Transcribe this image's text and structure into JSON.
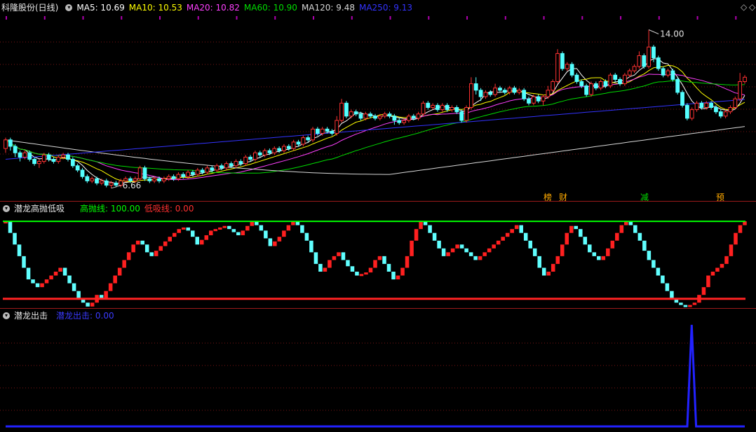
{
  "main_panel": {
    "title": "科隆股份(日线)",
    "ma_legend": [
      {
        "label": "MA5: 10.69",
        "color": "#ffffff"
      },
      {
        "label": "MA10: 10.53",
        "color": "#ffff00"
      },
      {
        "label": "MA20: 10.82",
        "color": "#ff40ff"
      },
      {
        "label": "MA60: 10.90",
        "color": "#00dd00"
      },
      {
        "label": "MA120: 9.48",
        "color": "#d8d8d8"
      },
      {
        "label": "MA250: 9.13",
        "color": "#3333ff"
      }
    ],
    "high_label": "14.00",
    "low_label": "6.66",
    "badges": [
      {
        "text": "榜",
        "color": "#ffaa00"
      },
      {
        "text": "财",
        "color": "#ffaa00"
      },
      {
        "text": "减",
        "color": "#00dd00"
      },
      {
        "text": "预",
        "color": "#ffaa00"
      }
    ]
  },
  "osc_panel": {
    "title": "潜龙高抛低吸",
    "high_label": "高抛线: 100.00",
    "low_label": "低吸线: 0.00",
    "high_color": "#00ff00",
    "low_color": "#ff2222"
  },
  "signal_panel": {
    "title": "潜龙出击",
    "label": "潜龙出击: 0.00",
    "color": "#2222ff"
  },
  "icons": {
    "collapse": "collapse-icon",
    "diamond": "diamond-icon",
    "corner": "corner-icon"
  },
  "chart_data": [
    {
      "type": "candlestick",
      "title": "科隆股份(日线)",
      "ylim": [
        6.2,
        14.6
      ],
      "annotations": [
        {
          "text": "14.00",
          "value": 14.0
        },
        {
          "text": "6.66",
          "value": 6.66
        }
      ],
      "candles": [
        [
          8.5,
          8.9,
          9.0,
          8.3
        ],
        [
          8.9,
          8.6,
          9.0,
          8.4
        ],
        [
          8.6,
          8.3,
          8.7,
          8.1
        ],
        [
          8.3,
          8.1,
          8.4,
          7.9
        ],
        [
          8.1,
          8.3,
          8.4,
          8.0
        ],
        [
          8.3,
          8.0,
          8.4,
          7.9
        ],
        [
          8.0,
          7.8,
          8.1,
          7.7
        ],
        [
          7.8,
          7.9,
          8.0,
          7.6
        ],
        [
          7.9,
          8.2,
          8.3,
          7.8
        ],
        [
          8.2,
          8.0,
          8.3,
          7.9
        ],
        [
          8.0,
          7.9,
          8.1,
          7.8
        ],
        [
          7.9,
          8.1,
          8.2,
          7.8
        ],
        [
          8.1,
          8.2,
          8.3,
          8.0
        ],
        [
          8.2,
          8.0,
          8.3,
          7.9
        ],
        [
          8.0,
          7.7,
          8.1,
          7.6
        ],
        [
          7.7,
          7.5,
          7.8,
          7.4
        ],
        [
          7.5,
          7.2,
          7.6,
          7.1
        ],
        [
          7.2,
          7.0,
          7.3,
          6.9
        ],
        [
          7.0,
          7.1,
          7.2,
          6.9
        ],
        [
          7.1,
          6.9,
          7.2,
          6.8
        ],
        [
          6.9,
          7.0,
          7.1,
          6.8
        ],
        [
          7.0,
          6.8,
          7.1,
          6.7
        ],
        [
          6.8,
          6.9,
          7.0,
          6.66
        ],
        [
          6.9,
          6.8,
          7.0,
          6.7
        ],
        [
          6.8,
          7.0,
          7.1,
          6.7
        ],
        [
          7.0,
          7.1,
          7.2,
          6.9
        ],
        [
          7.1,
          7.0,
          7.2,
          6.9
        ],
        [
          7.0,
          7.1,
          7.2,
          6.9
        ],
        [
          7.1,
          7.6,
          7.7,
          7.0
        ],
        [
          7.6,
          7.1,
          7.7,
          7.0
        ],
        [
          7.1,
          7.0,
          7.2,
          6.9
        ],
        [
          7.0,
          7.1,
          7.2,
          6.9
        ],
        [
          7.1,
          7.0,
          7.2,
          6.9
        ],
        [
          7.0,
          7.1,
          7.2,
          6.9
        ],
        [
          7.1,
          7.2,
          7.3,
          7.0
        ],
        [
          7.2,
          7.1,
          7.3,
          7.0
        ],
        [
          7.1,
          7.3,
          7.4,
          7.0
        ],
        [
          7.3,
          7.2,
          7.4,
          7.1
        ],
        [
          7.2,
          7.4,
          7.5,
          7.1
        ],
        [
          7.4,
          7.3,
          7.5,
          7.2
        ],
        [
          7.3,
          7.5,
          7.6,
          7.2
        ],
        [
          7.5,
          7.4,
          7.6,
          7.3
        ],
        [
          7.4,
          7.6,
          7.7,
          7.3
        ],
        [
          7.6,
          7.5,
          7.7,
          7.4
        ],
        [
          7.5,
          7.7,
          7.8,
          7.4
        ],
        [
          7.7,
          7.6,
          7.8,
          7.5
        ],
        [
          7.6,
          7.8,
          7.9,
          7.5
        ],
        [
          7.8,
          7.7,
          7.9,
          7.6
        ],
        [
          7.7,
          7.9,
          8.0,
          7.6
        ],
        [
          7.9,
          7.8,
          8.0,
          7.7
        ],
        [
          7.8,
          8.1,
          8.2,
          7.7
        ],
        [
          8.1,
          8.0,
          8.2,
          7.9
        ],
        [
          8.0,
          8.3,
          8.4,
          7.9
        ],
        [
          8.3,
          8.2,
          8.4,
          8.1
        ],
        [
          8.2,
          8.4,
          8.5,
          8.1
        ],
        [
          8.4,
          8.3,
          8.5,
          8.2
        ],
        [
          8.3,
          8.5,
          8.6,
          8.2
        ],
        [
          8.5,
          8.4,
          8.6,
          8.3
        ],
        [
          8.4,
          8.6,
          8.7,
          8.3
        ],
        [
          8.6,
          8.5,
          8.7,
          8.4
        ],
        [
          8.5,
          8.8,
          8.9,
          8.4
        ],
        [
          8.8,
          8.7,
          8.9,
          8.6
        ],
        [
          8.7,
          9.0,
          9.1,
          8.6
        ],
        [
          9.0,
          8.9,
          9.1,
          8.8
        ],
        [
          8.9,
          9.4,
          9.5,
          8.8
        ],
        [
          9.4,
          9.2,
          9.5,
          9.1
        ],
        [
          9.2,
          9.4,
          9.5,
          9.1
        ],
        [
          9.4,
          9.3,
          9.5,
          9.2
        ],
        [
          9.3,
          9.2,
          9.4,
          9.1
        ],
        [
          9.2,
          9.8,
          10.0,
          9.1
        ],
        [
          9.8,
          10.6,
          10.8,
          9.7
        ],
        [
          10.6,
          10.0,
          10.7,
          9.9
        ],
        [
          10.0,
          10.2,
          10.3,
          9.9
        ],
        [
          10.2,
          10.1,
          10.3,
          10.0
        ],
        [
          10.1,
          9.9,
          10.2,
          9.8
        ],
        [
          9.9,
          10.1,
          10.2,
          9.8
        ],
        [
          10.1,
          10.0,
          10.2,
          9.9
        ],
        [
          10.0,
          9.9,
          10.1,
          9.8
        ],
        [
          9.9,
          10.0,
          10.1,
          9.8
        ],
        [
          10.0,
          10.1,
          10.2,
          9.9
        ],
        [
          10.1,
          10.0,
          10.2,
          9.9
        ],
        [
          10.0,
          9.8,
          10.1,
          9.6
        ],
        [
          9.8,
          9.7,
          9.9,
          9.6
        ],
        [
          9.7,
          9.8,
          9.9,
          9.6
        ],
        [
          9.8,
          10.0,
          10.1,
          9.7
        ],
        [
          10.0,
          9.9,
          10.1,
          9.8
        ],
        [
          9.9,
          10.1,
          10.2,
          9.8
        ],
        [
          10.1,
          10.6,
          10.7,
          10.0
        ],
        [
          10.6,
          10.4,
          10.7,
          10.3
        ],
        [
          10.4,
          10.5,
          10.6,
          10.3
        ],
        [
          10.5,
          10.3,
          10.6,
          10.2
        ],
        [
          10.3,
          10.5,
          10.6,
          10.2
        ],
        [
          10.5,
          10.3,
          10.6,
          10.2
        ],
        [
          10.3,
          10.4,
          10.5,
          10.2
        ],
        [
          10.4,
          10.2,
          10.5,
          10.1
        ],
        [
          10.2,
          9.8,
          10.3,
          9.7
        ],
        [
          9.8,
          10.4,
          10.5,
          9.7
        ],
        [
          10.4,
          11.5,
          11.8,
          10.3
        ],
        [
          11.5,
          11.2,
          11.8,
          11.0
        ],
        [
          11.2,
          10.9,
          11.3,
          10.7
        ],
        [
          10.9,
          11.1,
          11.2,
          10.8
        ],
        [
          11.1,
          11.0,
          11.2,
          10.9
        ],
        [
          11.0,
          11.3,
          11.5,
          10.9
        ],
        [
          11.3,
          11.2,
          11.4,
          11.1
        ],
        [
          11.2,
          11.1,
          11.3,
          11.0
        ],
        [
          11.1,
          11.3,
          11.4,
          11.0
        ],
        [
          11.3,
          11.1,
          11.4,
          11.0
        ],
        [
          11.1,
          11.2,
          11.3,
          11.0
        ],
        [
          11.2,
          10.8,
          11.3,
          10.7
        ],
        [
          10.8,
          10.6,
          10.9,
          10.5
        ],
        [
          10.6,
          10.9,
          11.0,
          10.5
        ],
        [
          10.9,
          10.7,
          11.0,
          10.6
        ],
        [
          10.7,
          10.9,
          11.0,
          10.5
        ],
        [
          10.9,
          11.2,
          11.4,
          10.8
        ],
        [
          11.2,
          11.6,
          11.7,
          11.1
        ],
        [
          11.6,
          12.9,
          13.1,
          11.5
        ],
        [
          12.9,
          12.2,
          13.0,
          12.1
        ],
        [
          12.2,
          12.4,
          12.5,
          12.1
        ],
        [
          12.4,
          11.9,
          12.5,
          11.8
        ],
        [
          11.9,
          11.6,
          12.0,
          11.5
        ],
        [
          11.6,
          11.4,
          11.7,
          11.3
        ],
        [
          11.4,
          11.0,
          11.5,
          10.9
        ],
        [
          11.0,
          11.5,
          11.6,
          10.9
        ],
        [
          11.5,
          11.3,
          11.6,
          11.2
        ],
        [
          11.3,
          11.6,
          11.7,
          11.2
        ],
        [
          11.6,
          11.4,
          11.7,
          11.3
        ],
        [
          11.4,
          11.9,
          12.0,
          11.3
        ],
        [
          11.9,
          11.7,
          12.0,
          11.6
        ],
        [
          11.7,
          11.5,
          11.8,
          11.4
        ],
        [
          11.5,
          11.9,
          12.0,
          11.4
        ],
        [
          11.9,
          12.1,
          12.2,
          11.8
        ],
        [
          12.1,
          12.3,
          12.4,
          12.0
        ],
        [
          12.3,
          12.8,
          13.0,
          12.2
        ],
        [
          12.8,
          12.3,
          12.9,
          12.2
        ],
        [
          12.3,
          13.2,
          14.0,
          12.2
        ],
        [
          13.2,
          12.7,
          13.3,
          12.5
        ],
        [
          12.7,
          12.2,
          12.8,
          12.1
        ],
        [
          12.2,
          11.9,
          12.3,
          11.8
        ],
        [
          11.9,
          12.1,
          12.2,
          11.8
        ],
        [
          12.1,
          11.7,
          12.2,
          11.6
        ],
        [
          11.7,
          11.1,
          11.8,
          11.0
        ],
        [
          11.1,
          10.5,
          11.2,
          10.4
        ],
        [
          10.5,
          9.9,
          10.6,
          9.8
        ],
        [
          9.9,
          10.3,
          10.4,
          9.8
        ],
        [
          10.3,
          10.6,
          10.7,
          10.2
        ],
        [
          10.6,
          10.4,
          10.7,
          10.3
        ],
        [
          10.4,
          10.6,
          10.7,
          10.3
        ],
        [
          10.6,
          10.4,
          10.7,
          10.3
        ],
        [
          10.4,
          10.2,
          10.5,
          10.1
        ],
        [
          10.2,
          10.0,
          10.3,
          9.9
        ],
        [
          10.0,
          10.2,
          10.3,
          9.9
        ],
        [
          10.2,
          10.4,
          10.5,
          10.1
        ],
        [
          10.4,
          10.8,
          10.9,
          10.3
        ],
        [
          10.8,
          11.6,
          12.0,
          10.7
        ],
        [
          11.6,
          11.8,
          11.9,
          11.5
        ]
      ],
      "series": [
        {
          "name": "MA5",
          "color": "#ffffff"
        },
        {
          "name": "MA10",
          "color": "#ffff00"
        },
        {
          "name": "MA20",
          "color": "#ff40ff"
        },
        {
          "name": "MA60",
          "color": "#00dd00"
        },
        {
          "name": "MA120",
          "color": "#d8d8d8"
        },
        {
          "name": "MA250",
          "color": "#3333ff"
        }
      ]
    },
    {
      "type": "bar",
      "title": "潜龙高抛低吸",
      "ylim": [
        -12,
        110
      ],
      "reference_lines": [
        {
          "name": "高抛线",
          "value": 100
        },
        {
          "name": "低吸线",
          "value": 0
        }
      ],
      "values": [
        100,
        85,
        70,
        55,
        40,
        25,
        20,
        15,
        20,
        25,
        30,
        35,
        40,
        30,
        20,
        10,
        0,
        -5,
        -10,
        -5,
        5,
        0,
        10,
        20,
        30,
        40,
        50,
        60,
        70,
        75,
        70,
        60,
        55,
        62,
        68,
        74,
        80,
        85,
        90,
        92,
        88,
        80,
        70,
        76,
        82,
        88,
        90,
        92,
        94,
        90,
        86,
        82,
        88,
        94,
        100,
        95,
        88,
        78,
        68,
        74,
        80,
        88,
        95,
        100,
        95,
        85,
        75,
        60,
        45,
        35,
        40,
        50,
        55,
        60,
        50,
        42,
        35,
        30,
        32,
        34,
        40,
        50,
        55,
        45,
        35,
        25,
        30,
        40,
        55,
        75,
        90,
        100,
        95,
        85,
        75,
        65,
        55,
        60,
        65,
        70,
        65,
        60,
        55,
        50,
        55,
        60,
        65,
        70,
        75,
        80,
        85,
        90,
        95,
        85,
        75,
        65,
        55,
        40,
        30,
        35,
        45,
        55,
        70,
        85,
        94,
        90,
        80,
        70,
        60,
        55,
        50,
        55,
        65,
        75,
        85,
        95,
        100,
        95,
        85,
        75,
        62,
        50,
        40,
        30,
        20,
        10,
        0,
        -5,
        -8,
        -10,
        -8,
        -5,
        5,
        15,
        30,
        35,
        40,
        45,
        55,
        70,
        85,
        95,
        100
      ]
    },
    {
      "type": "line",
      "title": "潜龙出击",
      "ylim": [
        0,
        100
      ],
      "series": [
        {
          "name": "潜龙出击",
          "values": [
            0,
            0,
            0,
            0,
            0,
            0,
            0,
            0,
            0,
            0,
            0,
            0,
            0,
            0,
            0,
            0,
            0,
            0,
            0,
            0,
            0,
            0,
            0,
            0,
            0,
            0,
            0,
            0,
            0,
            0,
            0,
            0,
            0,
            0,
            0,
            0,
            0,
            0,
            0,
            0,
            0,
            0,
            0,
            0,
            0,
            0,
            0,
            0,
            0,
            0,
            0,
            0,
            0,
            0,
            0,
            0,
            0,
            0,
            0,
            0,
            0,
            0,
            0,
            0,
            0,
            0,
            0,
            0,
            0,
            0,
            0,
            0,
            0,
            0,
            0,
            0,
            0,
            0,
            0,
            0,
            0,
            0,
            0,
            0,
            0,
            0,
            0,
            0,
            0,
            0,
            0,
            0,
            0,
            0,
            0,
            0,
            0,
            0,
            0,
            0,
            0,
            0,
            0,
            0,
            0,
            0,
            0,
            0,
            0,
            0,
            0,
            0,
            0,
            0,
            0,
            0,
            0,
            0,
            0,
            0,
            0,
            0,
            0,
            0,
            0,
            0,
            0,
            0,
            0,
            0,
            0,
            0,
            0,
            0,
            0,
            0,
            0,
            0,
            0,
            0,
            0,
            0,
            0,
            0,
            0,
            0,
            0,
            0,
            0,
            0,
            0,
            0,
            0,
            0,
            0,
            100,
            0,
            0,
            0,
            0,
            0,
            0,
            0,
            0,
            0,
            0,
            0,
            0
          ]
        }
      ]
    }
  ]
}
